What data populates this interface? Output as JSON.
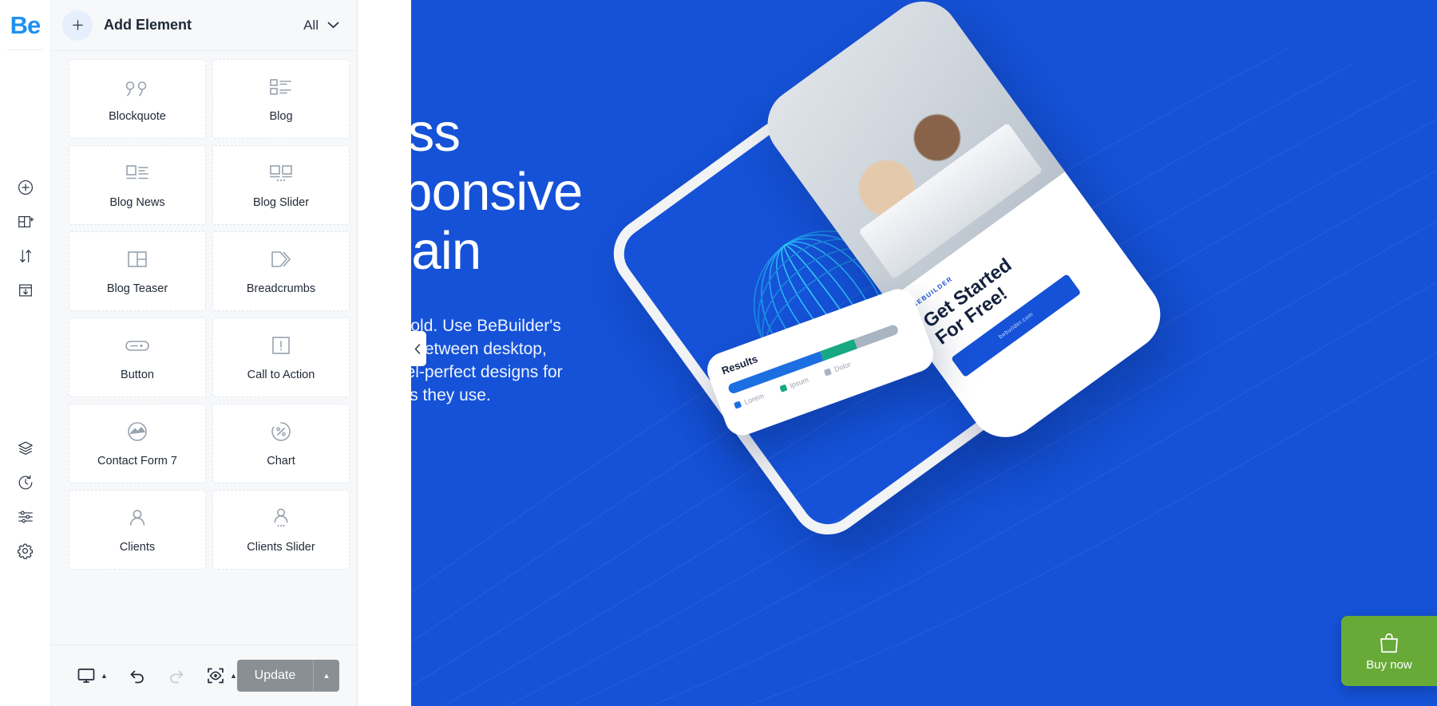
{
  "app": {
    "logo": "Be"
  },
  "rail": {
    "items": [
      {
        "name": "add-element-icon",
        "title": "Add Element"
      },
      {
        "name": "add-section-icon",
        "title": "Add Section"
      },
      {
        "name": "sort-order-icon",
        "title": "Reorder"
      },
      {
        "name": "import-template-icon",
        "title": "Import Template"
      },
      {
        "name": "layers-icon",
        "title": "Layers"
      },
      {
        "name": "history-icon",
        "title": "History"
      },
      {
        "name": "sliders-icon",
        "title": "Options"
      },
      {
        "name": "settings-gear-icon",
        "title": "Settings"
      }
    ]
  },
  "panel": {
    "title": "Add Element",
    "add_button_icon": "plus-icon",
    "filter": {
      "label": "All",
      "icon": "chevron-down-icon"
    },
    "elements": [
      {
        "label": "Blockquote",
        "icon": "quote-icon"
      },
      {
        "label": "Blog",
        "icon": "blog-list-icon"
      },
      {
        "label": "Blog News",
        "icon": "blog-news-icon"
      },
      {
        "label": "Blog Slider",
        "icon": "blog-slider-icon"
      },
      {
        "label": "Blog Teaser",
        "icon": "blog-teaser-icon"
      },
      {
        "label": "Breadcrumbs",
        "icon": "chevrons-right-icon"
      },
      {
        "label": "Button",
        "icon": "button-pill-icon"
      },
      {
        "label": "Call to Action",
        "icon": "exclamation-box-icon"
      },
      {
        "label": "Contact Form 7",
        "icon": "contact-form-icon"
      },
      {
        "label": "Chart",
        "icon": "chart-percent-icon"
      },
      {
        "label": "Clients",
        "icon": "user-icon"
      },
      {
        "label": "Clients Slider",
        "icon": "user-slider-icon"
      }
    ]
  },
  "toolbar": {
    "device_icon": "monitor-icon",
    "device_caret": "caret-up-icon",
    "undo_icon": "undo-icon",
    "redo_icon": "redo-icon",
    "preview_icon": "preview-eye-icon",
    "preview_caret": "caret-up-icon",
    "update_label": "Update",
    "update_caret": "caret-up-icon"
  },
  "preview": {
    "collapse_icon": "chevron-left-icon",
    "hero": {
      "title": "tress\nesponsive\nAgain",
      "body": "t in the cold. Use BeBuilder's\no Switch between desktop,\neate pixel-perfect designs for\nh devices they use."
    },
    "phone": {
      "brand": "BEBUILDER",
      "headline": "Get Started\nFor Free!",
      "cta_label": "bebuilder.com"
    },
    "results_card": {
      "title": "Results",
      "legend": [
        {
          "label": "Lorem",
          "color": "#1c6fe0"
        },
        {
          "label": "Ipsum",
          "color": "#18a884"
        },
        {
          "label": "Dolor",
          "color": "#a9b4c2"
        }
      ]
    },
    "buy_now": {
      "label": "Buy now",
      "icon": "shopping-bag-icon",
      "color": "#67aa37"
    }
  },
  "chart_data": {
    "type": "bar",
    "title": "Results",
    "categories": [
      "Lorem",
      "Ipsum",
      "Dolor"
    ],
    "values": [
      55,
      20,
      25
    ],
    "colors": [
      "#1c6fe0",
      "#18a884",
      "#a9b4c2"
    ],
    "xlabel": "",
    "ylabel": "",
    "ylim": [
      0,
      100
    ],
    "legend": "bottom",
    "grid": false
  }
}
